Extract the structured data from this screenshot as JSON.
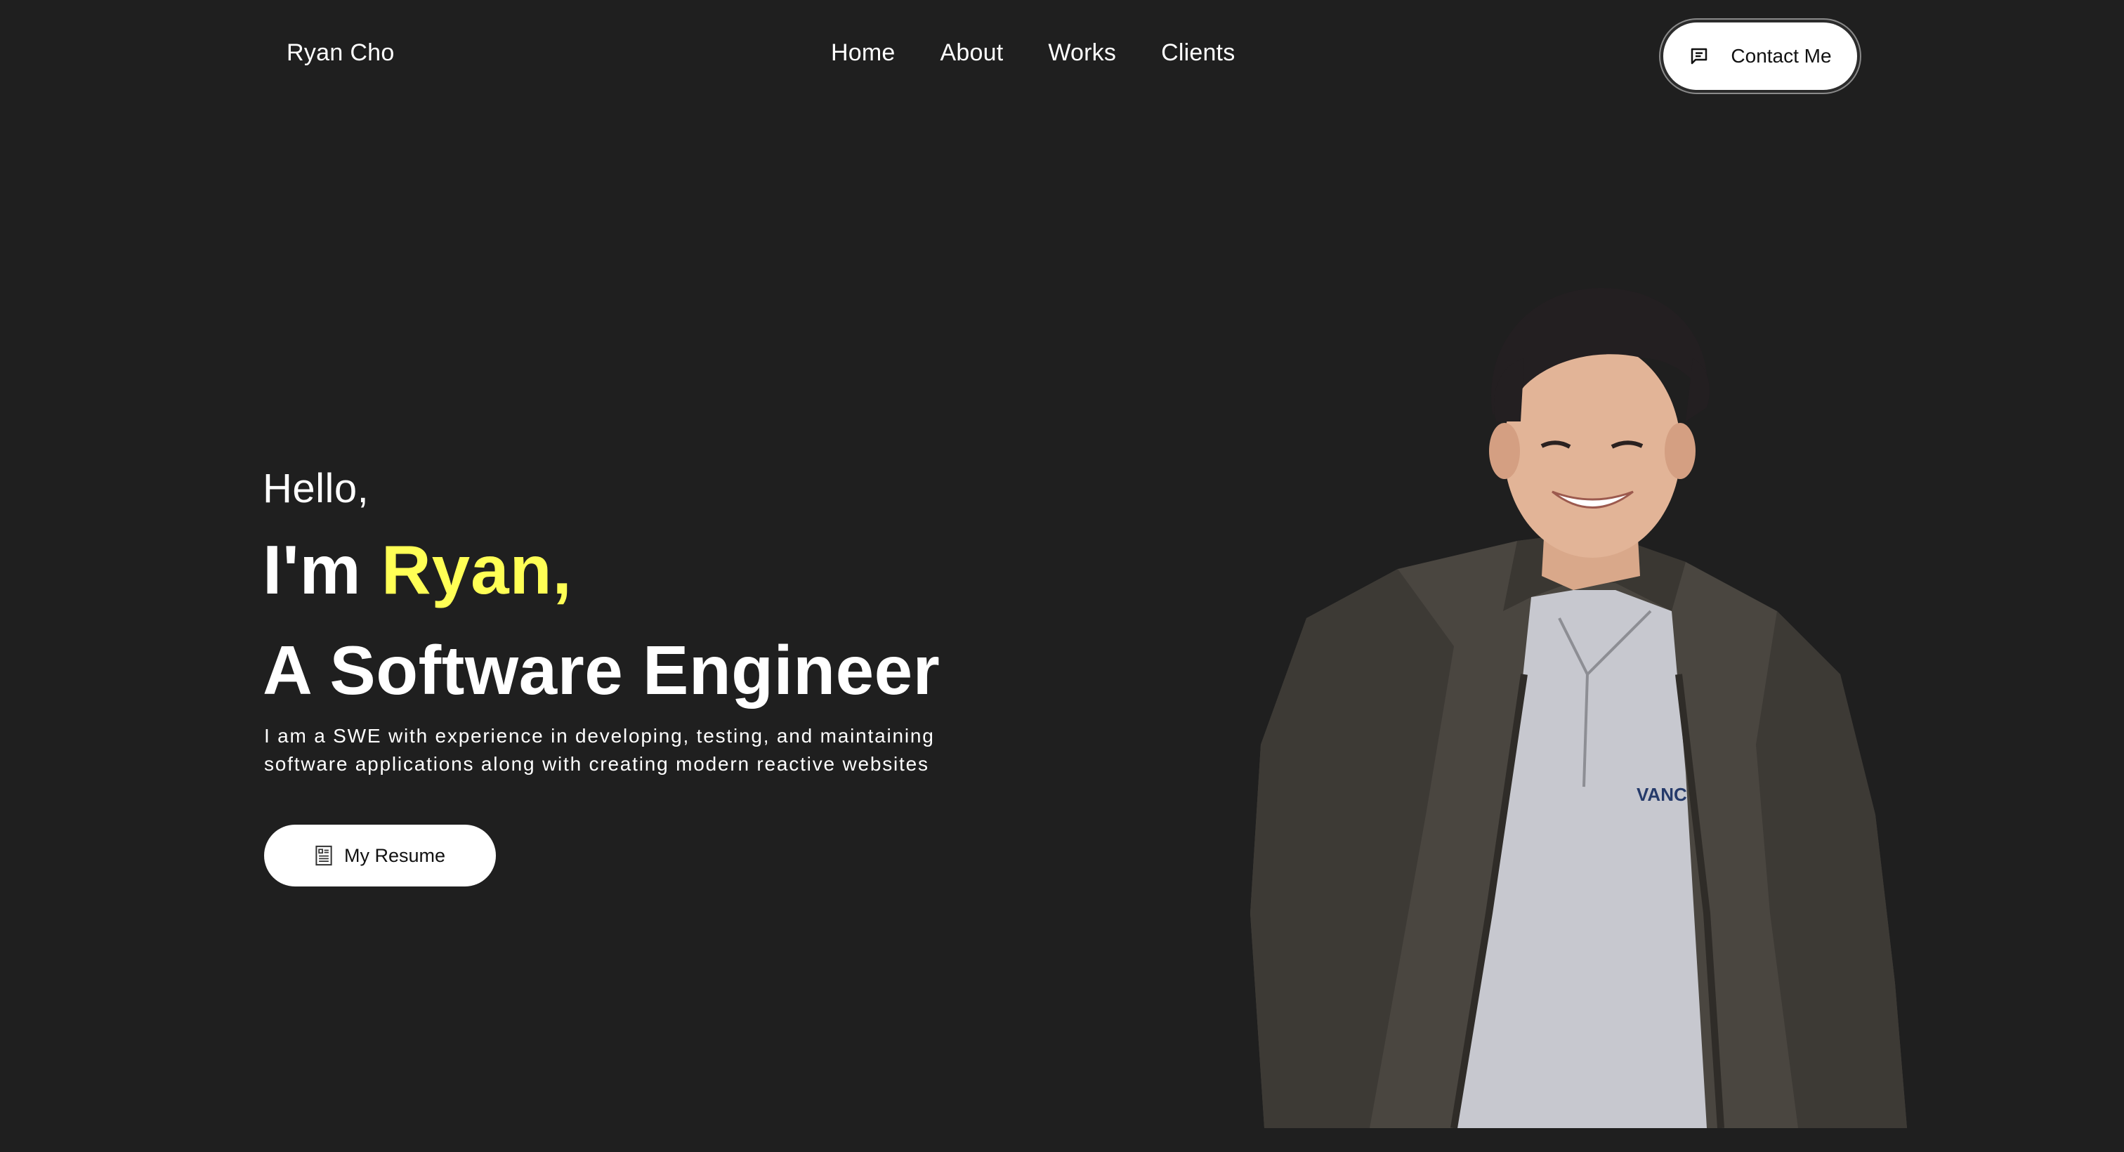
{
  "header": {
    "logo": "Ryan Cho",
    "nav": [
      "Home",
      "About",
      "Works",
      "Clients"
    ],
    "contact_label": "Contact Me",
    "contact_icon": "message-icon"
  },
  "hero": {
    "greeting": "Hello,",
    "intro_prefix": "I'm ",
    "intro_name": "Ryan,",
    "role": "A Software Engineer",
    "description": "I am a SWE with experience in developing, testing, and maintaining software applications along with creating modern reactive websites",
    "resume_label": "My Resume",
    "resume_icon": "document-icon",
    "accent_color": "#ffff55"
  },
  "portrait": {
    "shirt_print": "VANC"
  }
}
